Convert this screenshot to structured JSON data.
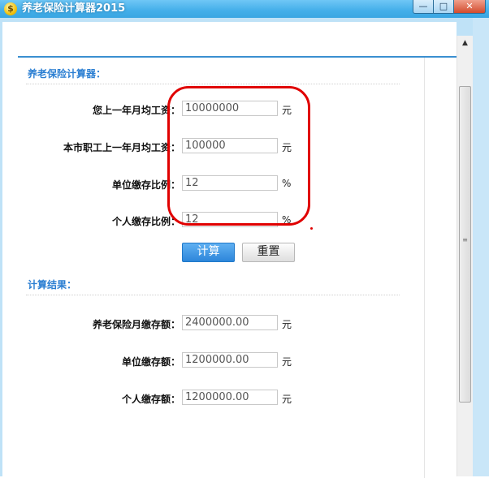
{
  "window": {
    "title": "养老保险计算器2015",
    "app_icon_glyph": "$",
    "app_icon_name": "coin-icon",
    "minimize_glyph": "—",
    "maximize_glyph": "□",
    "close_glyph": "✕",
    "accent_color": "#3aa6e2"
  },
  "calculator": {
    "section_title": "养老保险计算器：",
    "rows": [
      {
        "label": "您上一年月均工资：",
        "value": "10000000",
        "unit": "元"
      },
      {
        "label": "本市职工上一年月均工资：",
        "value": "100000",
        "unit": "元"
      },
      {
        "label": "单位缴存比例：",
        "value": "12",
        "unit": "%"
      },
      {
        "label": "个人缴存比例：",
        "value": "12",
        "unit": "%"
      }
    ],
    "calc_button": "计算",
    "reset_button": "重置"
  },
  "results": {
    "section_title": "计算结果：",
    "rows": [
      {
        "label": "养老保险月缴存额：",
        "value": "2400000.00",
        "unit": "元"
      },
      {
        "label": "单位缴存额：",
        "value": "1200000.00",
        "unit": "元"
      },
      {
        "label": "个人缴存额：",
        "value": "1200000.00",
        "unit": "元"
      }
    ]
  },
  "scrollbar": {
    "up_glyph": "▲",
    "grip_glyph": "≡"
  },
  "annotation_color": "#e00000"
}
